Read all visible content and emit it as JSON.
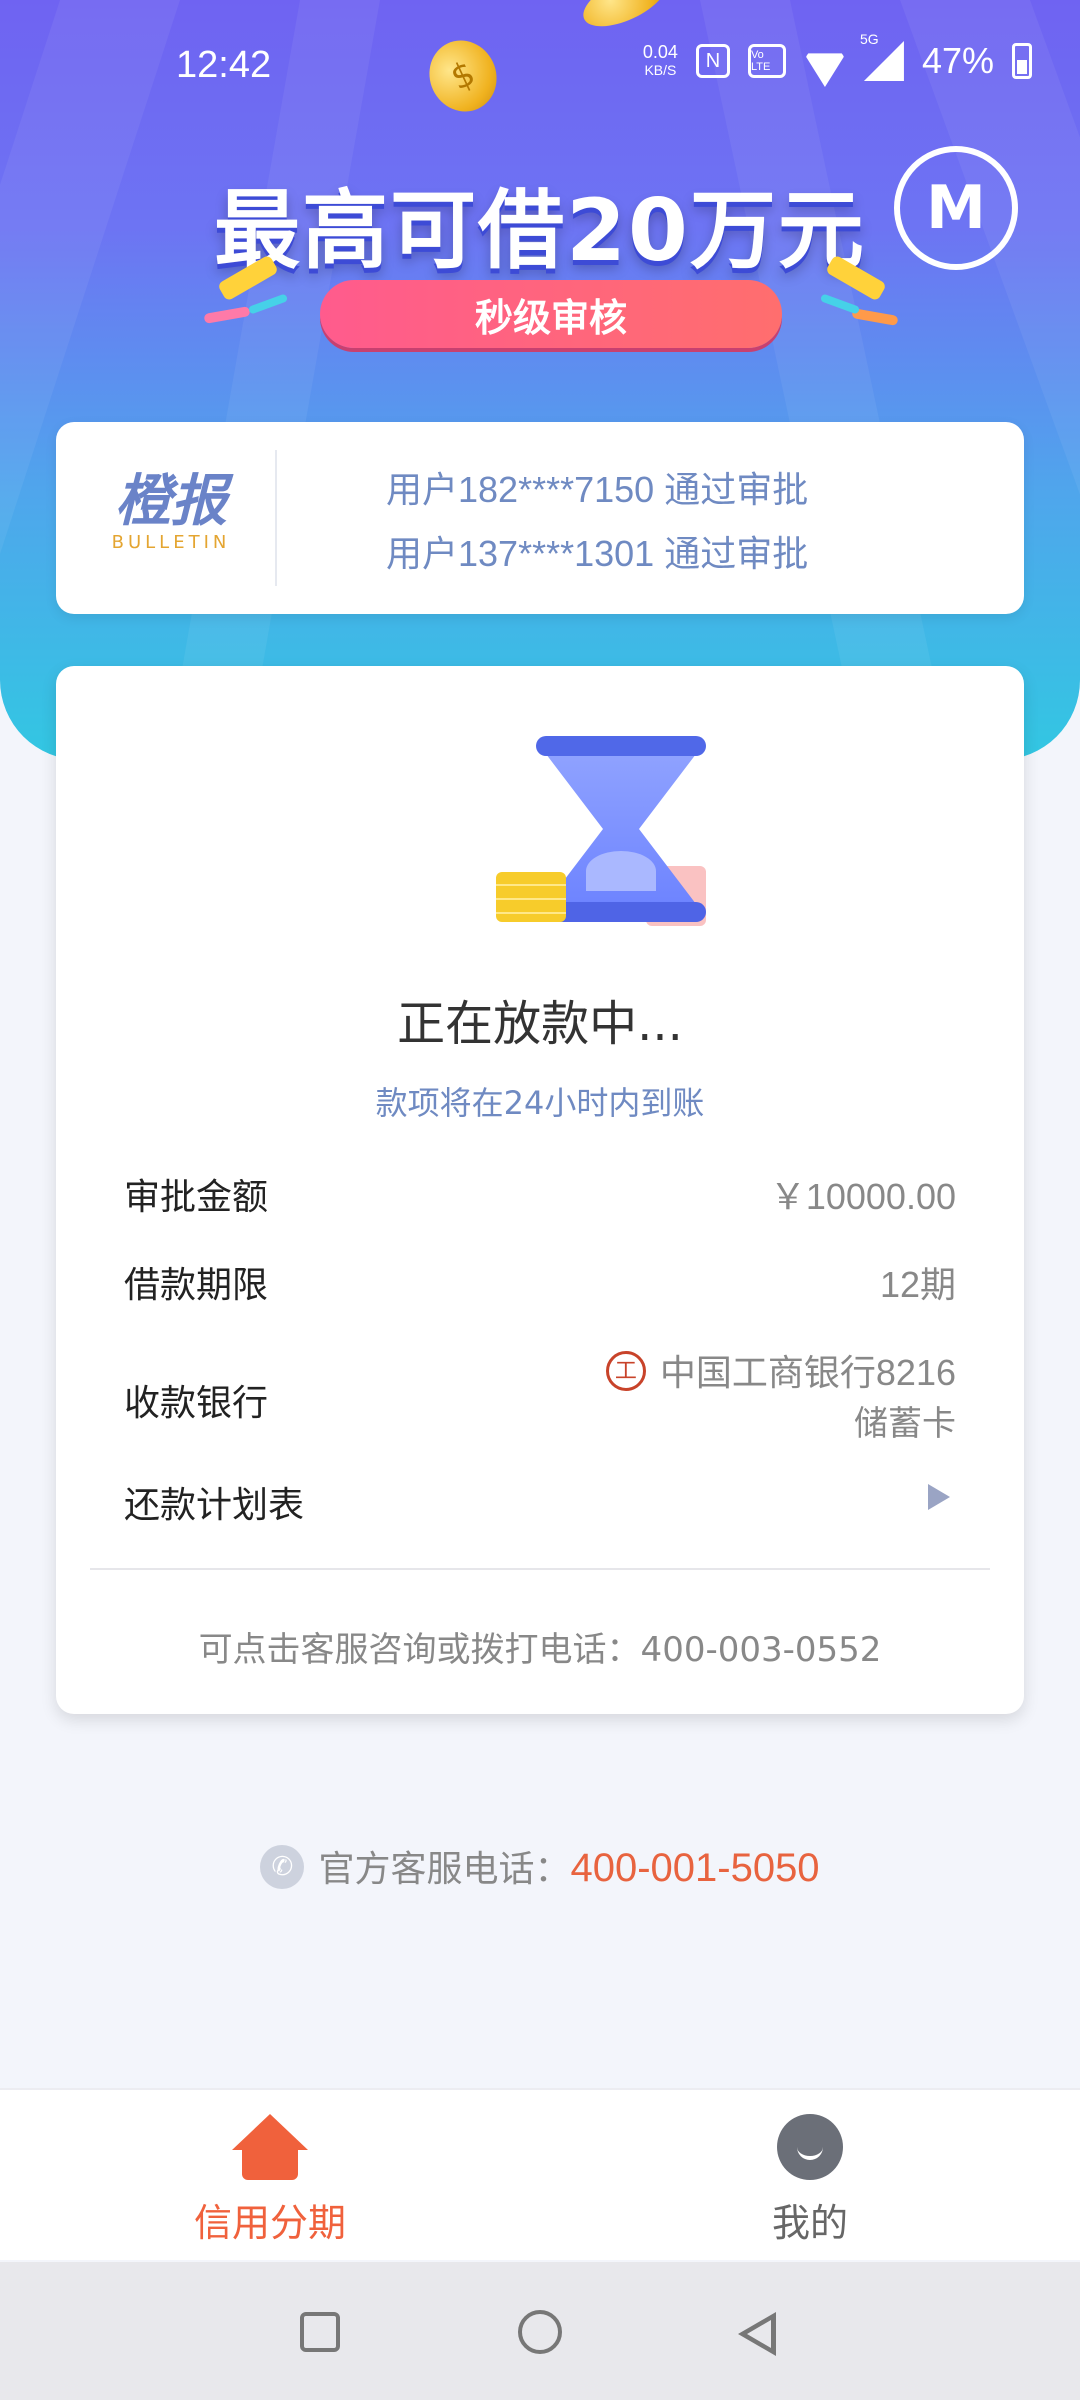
{
  "status_bar": {
    "time": "12:42",
    "net_speed": "0.04",
    "net_unit": "KB/S",
    "nfc_icon": "N",
    "volte_label": "Vo LTE",
    "network": "5G",
    "battery": "47%"
  },
  "banner": {
    "headline": "最高可借20万元",
    "badge": "秒级审核",
    "coin_symbol": "$",
    "profile_glyph": "M"
  },
  "bulletin": {
    "logo_cn": "橙报",
    "logo_en": "BULLETIN",
    "messages": [
      "用户182****7150 通过审批",
      "用户137****1301 通过审批"
    ]
  },
  "loan_card": {
    "status_title": "正在放款中...",
    "status_sub": "款项将在24小时内到账",
    "rows": {
      "amount_label": "审批金额",
      "amount_value": "￥10000.00",
      "term_label": "借款期限",
      "term_value": "12期",
      "bank_label": "收款银行",
      "bank_value": "中国工商银行8216",
      "bank_card_type": "储蓄卡",
      "schedule_label": "还款计划表"
    },
    "hint": "可点击客服咨询或拨打电话：400-003-0552"
  },
  "hotline": {
    "label": "官方客服电话：",
    "number": "400-001-5050"
  },
  "tabbar": {
    "tabs": [
      {
        "label": "信用分期",
        "icon": "home-icon",
        "active": true
      },
      {
        "label": "我的",
        "icon": "profile-icon",
        "active": false
      }
    ]
  },
  "colors": {
    "accent": "#f0613c",
    "header_top": "#6f63f2",
    "header_bottom": "#32c7e2",
    "info_blue": "#6f8ac2"
  }
}
